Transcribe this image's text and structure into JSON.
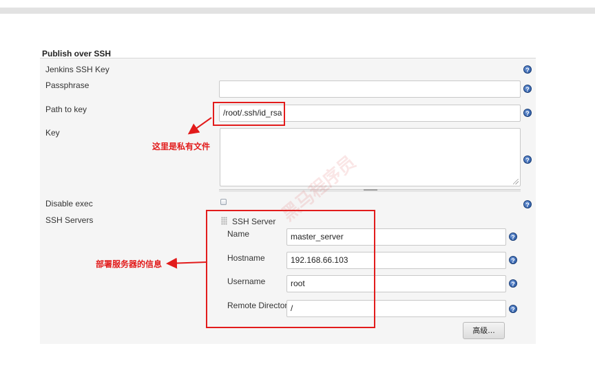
{
  "section": {
    "title": "Publish over SSH"
  },
  "fields": {
    "jenkins_ssh_key": {
      "label": "Jenkins SSH Key"
    },
    "passphrase": {
      "label": "Passphrase",
      "value": ""
    },
    "path_to_key": {
      "label": "Path to key",
      "value": "/root/.ssh/id_rsa"
    },
    "key": {
      "label": "Key",
      "value": ""
    },
    "disable_exec": {
      "label": "Disable exec",
      "checked": false
    },
    "ssh_servers": {
      "label": "SSH Servers"
    }
  },
  "ssh_server": {
    "header": "SSH Server",
    "name": {
      "label": "Name",
      "value": "master_server"
    },
    "hostname": {
      "label": "Hostname",
      "value": "192.168.66.103"
    },
    "username": {
      "label": "Username",
      "value": "root"
    },
    "remote_directory": {
      "label": "Remote Directory",
      "value": "/"
    },
    "advanced_button": "高级..."
  },
  "annotations": {
    "private_key_note": "这里是私有文件",
    "server_info_note": "部署服务器的信息"
  },
  "help_glyph": "?",
  "watermark": "黑马程序员",
  "colors": {
    "annotation_red": "#e21b1b",
    "help_icon_blue": "#1e4f9c",
    "panel_background": "#f5f5f5"
  }
}
